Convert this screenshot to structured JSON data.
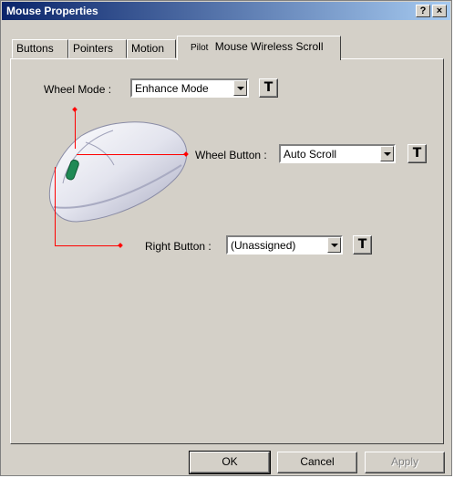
{
  "window": {
    "title": "Mouse Properties"
  },
  "titlebar_buttons": {
    "help": "?",
    "close": "×"
  },
  "tabs": [
    {
      "label": "Buttons"
    },
    {
      "label": "Pointers"
    },
    {
      "label": "Motion"
    },
    {
      "label": "Pilot",
      "label2": "Mouse Wireless Scroll"
    }
  ],
  "settings": {
    "wheel_mode": {
      "label": "Wheel Mode :",
      "value": "Enhance Mode"
    },
    "wheel_button": {
      "label": "Wheel Button :",
      "value": "Auto Scroll"
    },
    "right_button": {
      "label": "Right Button :",
      "value": "(Unassigned)"
    }
  },
  "icons": {
    "test_button_icon": "T"
  },
  "buttons": {
    "ok": "OK",
    "cancel": "Cancel",
    "apply": "Apply"
  }
}
